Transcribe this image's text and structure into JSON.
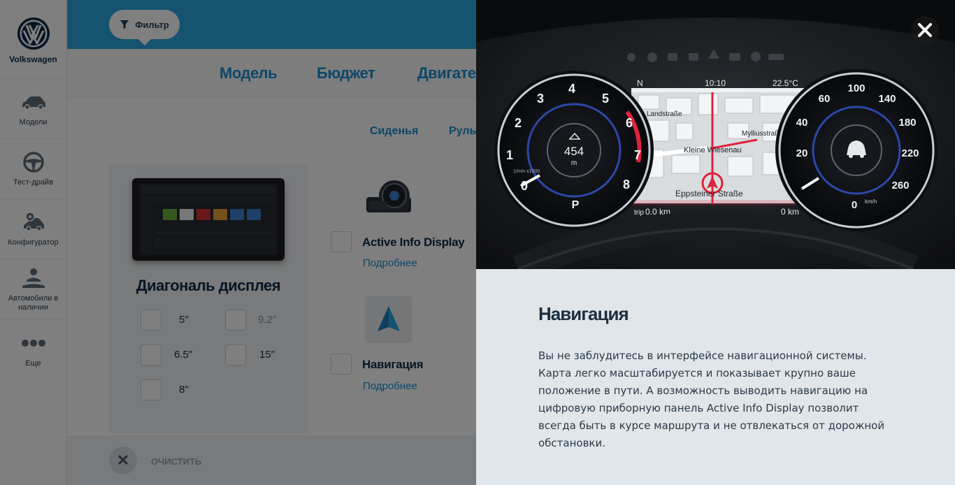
{
  "brand": {
    "name": "Volkswagen"
  },
  "sidebar": {
    "items": [
      {
        "label": "Модели",
        "icon": "car-icon"
      },
      {
        "label": "Тест-драйв",
        "icon": "steering-wheel-icon"
      },
      {
        "label": "Конфигуратор",
        "icon": "car-gear-icon"
      },
      {
        "label": "Автомобили в наличии",
        "icon": "car-lift-icon"
      },
      {
        "label": "Еще",
        "icon": "more-dots-icon"
      }
    ]
  },
  "toolbar": {
    "filter_label": "Фильтр"
  },
  "tabs": [
    "Модель",
    "Бюджет",
    "Двигатель"
  ],
  "subtabs": [
    "Сиденья",
    "Руль"
  ],
  "display_card": {
    "title": "Диагональ дисплея",
    "options": [
      "5″",
      "9.2″",
      "6.5″",
      "15″",
      "8″"
    ]
  },
  "features": [
    {
      "title": "Active Info Display",
      "link": "Подробнее",
      "icon": "instrument-cluster-icon"
    },
    {
      "title": "Навигация",
      "link": "Подробнее",
      "icon": "navigation-arrow-icon"
    }
  ],
  "footer": {
    "clear_label": "ОЧИСТИТЬ"
  },
  "cockpit": {
    "time": "10:10",
    "temperature": "22.5°C",
    "altitude": "454",
    "altitude_unit": "m",
    "trip_label": "trip",
    "trip_value": "0.0 km",
    "range_value": "0 km",
    "compass": "N",
    "streets": [
      "Landstraße",
      "Mylliusstraße",
      "Kleine Wiesenau",
      "Eppsteiner Straße"
    ],
    "speed_unit": "km/h",
    "tacho_unit": "1/min x1000",
    "gear": "P",
    "colors": {
      "accent": "#2aa7e0",
      "route": "#e0223a"
    }
  },
  "modal": {
    "title": "Навигация",
    "text": "Вы не заблудитесь в интерфейсе навигационной системы. Карта легко масштабируется и показывает крупно ваше положение в пути. А возможность выводить навигацию на цифровую приборную панель Active Info Display позволит всегда быть в курсе маршрута и не отвлекаться от дорожной обстановки."
  }
}
